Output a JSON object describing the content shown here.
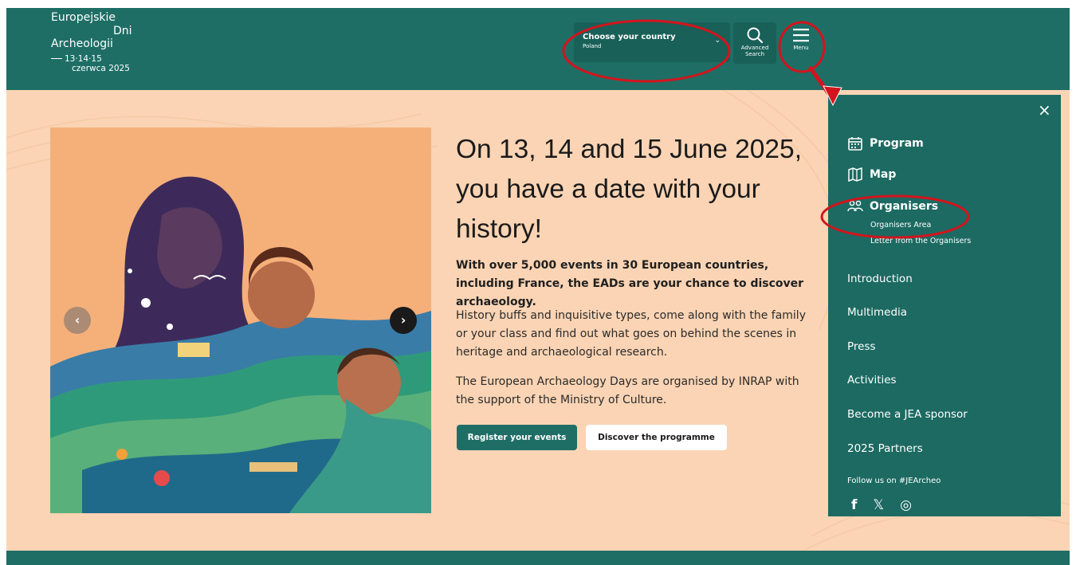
{
  "header": {
    "logo": {
      "line1": "Europejskie",
      "line2": "Dni",
      "line3": "Archeologii",
      "dates": "13·14·15",
      "month": "czerwca 2025"
    },
    "country_select": {
      "label": "Choose your country",
      "value": "Poland"
    },
    "advanced_search": {
      "label_line1": "Advanced",
      "label_line2": "Search",
      "icon": "search-icon"
    },
    "menu_button": {
      "label": "Menu",
      "icon": "hamburger-icon"
    }
  },
  "hero": {
    "headline_line1": "On 13, 14 and 15 June 2025,",
    "headline_line2": "you have a date with your",
    "headline_line3": "history!",
    "lead": "With over 5,000 events in 30 European countries, including France, the EADs are your chance to discover archaeology.",
    "paragraph1": "History buffs and inquisitive types, come along with the family or your class and find out what goes on behind the scenes in heritage and archaeological research.",
    "paragraph2": "The European Archaeology Days are organised by INRAP with the support of the Ministry of Culture.",
    "register_button": "Register your events",
    "discover_button": "Discover the programme",
    "prev_icon": "chevron-left-icon",
    "next_icon": "chevron-right-icon"
  },
  "menu": {
    "close_label": "×",
    "program": {
      "label": "Program",
      "icon": "calendar-icon"
    },
    "map": {
      "label": "Map",
      "icon": "map-icon"
    },
    "organisers": {
      "label": "Organisers",
      "icon": "people-icon",
      "sub_items": [
        "Organisers Area",
        "Letter from the Organisers"
      ]
    },
    "items": [
      "Introduction",
      "Multimedia",
      "Press",
      "Activities",
      "Become a JEA sponsor",
      "2025 Partners"
    ],
    "follow_label": "Follow us on #JEArcheo",
    "socials": [
      {
        "label": "f",
        "icon": "facebook-icon"
      },
      {
        "label": "𝕏",
        "icon": "x-icon"
      },
      {
        "label": "◎",
        "icon": "instagram-icon"
      }
    ]
  },
  "colors": {
    "brand_teal": "#1e6e66",
    "panel_teal": "#1c6a62",
    "hero_background": "#fad4b4",
    "annotation_red": "#d4141c"
  }
}
